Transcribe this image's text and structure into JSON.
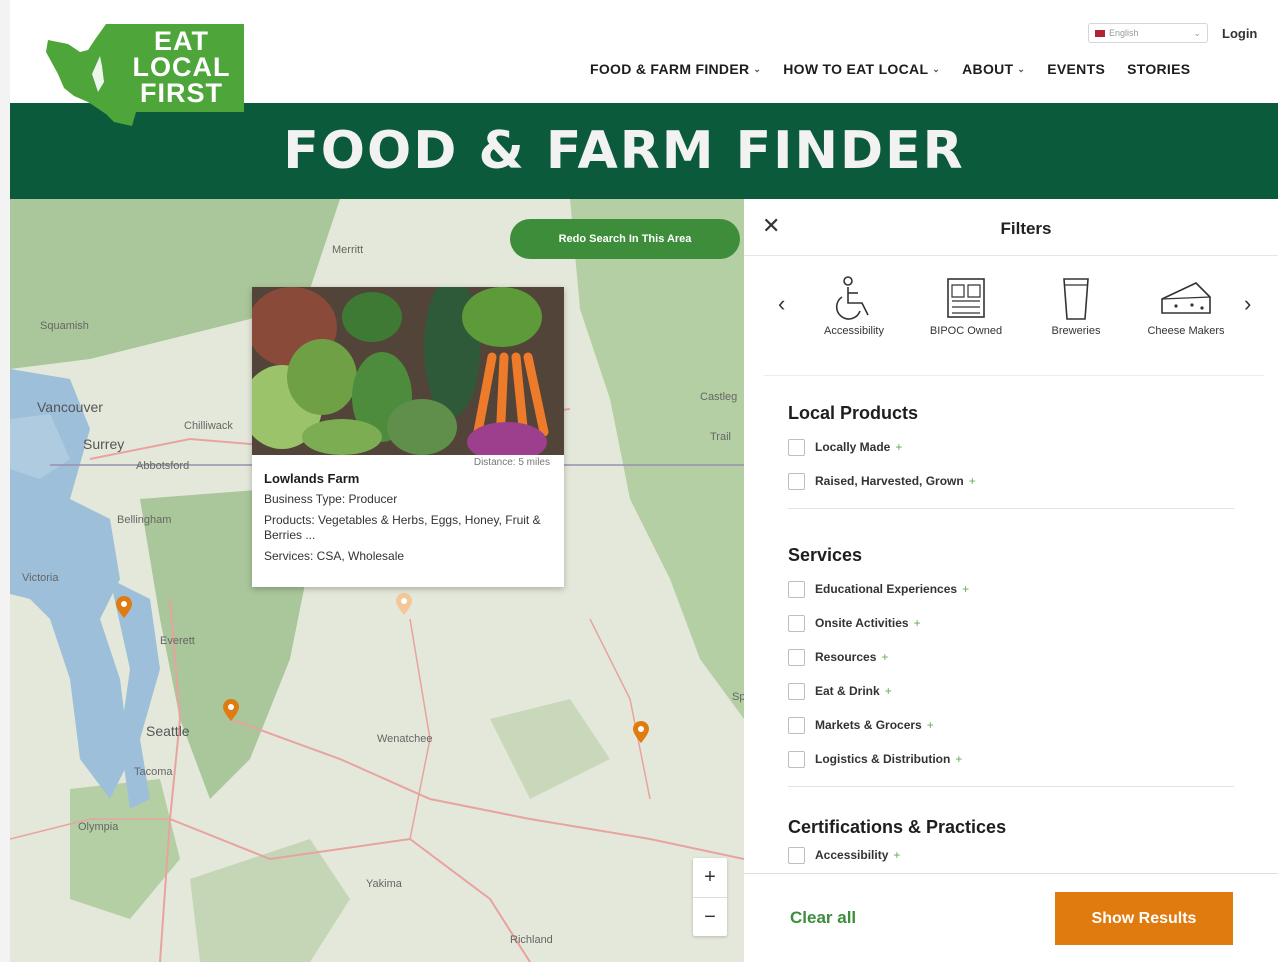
{
  "logo": {
    "line1": "EAT",
    "line2": "LOCAL",
    "line3": "FIRST"
  },
  "header": {
    "language": "English",
    "login": "Login",
    "nav": [
      {
        "label": "FOOD & FARM FINDER"
      },
      {
        "label": "HOW TO EAT LOCAL"
      },
      {
        "label": "ABOUT"
      },
      {
        "label": "EVENTS"
      },
      {
        "label": "STORIES"
      }
    ]
  },
  "banner": {
    "title": "FOOD & FARM FINDER"
  },
  "map": {
    "redo_label": "Redo Search In This Area",
    "labels": [
      "Merritt",
      "Squamish",
      "Vancouver",
      "Surrey",
      "Chilliwack",
      "Abbotsford",
      "Bellingham",
      "Victoria",
      "Everett",
      "Seattle",
      "Tacoma",
      "Olympia",
      "Wenatchee",
      "Yakima",
      "Richland",
      "Castleg",
      "Trail",
      "Sp"
    ],
    "zoom_in": "+",
    "zoom_out": "−"
  },
  "popup": {
    "distance": "Distance: 5 miles",
    "name": "Lowlands Farm",
    "business_type": "Business Type: Producer",
    "products": "Products: Vegetables & Herbs, Eggs, Honey, Fruit & Berries ...",
    "services": "Services: CSA, Wholesale"
  },
  "filters": {
    "title": "Filters",
    "categories": [
      {
        "label": "Accessibility",
        "icon": "accessibility-icon"
      },
      {
        "label": "BIPOC Owned",
        "icon": "bipoc-owned-icon"
      },
      {
        "label": "Breweries",
        "icon": "breweries-icon"
      },
      {
        "label": "Cheese Makers",
        "icon": "cheese-makers-icon"
      }
    ],
    "local_products": {
      "title": "Local Products",
      "options": [
        "Locally Made",
        "Raised, Harvested, Grown"
      ]
    },
    "services": {
      "title": "Services",
      "options": [
        "Educational Experiences",
        "Onsite Activities",
        "Resources",
        "Eat & Drink",
        "Markets & Grocers",
        "Logistics & Distribution"
      ]
    },
    "certifications": {
      "title": "Certifications & Practices",
      "options": [
        "Accessibility"
      ]
    },
    "clear_all": "Clear all",
    "show_results": "Show Results"
  },
  "colors": {
    "brand_green": "#0b5a3b",
    "logo_green": "#4ea53a",
    "accent_orange": "#e07b10",
    "button_green": "#3d8d3a"
  }
}
